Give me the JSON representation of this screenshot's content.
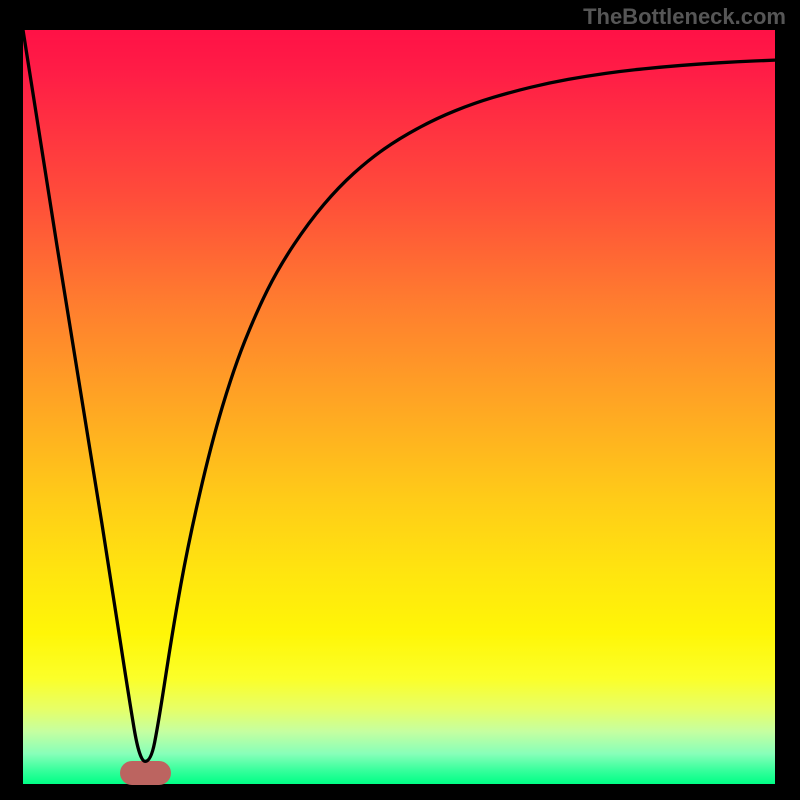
{
  "watermark": "TheBottleneck.com",
  "chart_data": {
    "type": "line",
    "title": "",
    "xlabel": "",
    "ylabel": "",
    "xlim": [
      0,
      100
    ],
    "ylim": [
      0,
      100
    ],
    "series": [
      {
        "name": "bottleneck-curve",
        "x": [
          0,
          3,
          6,
          9,
          12,
          14,
          15.5,
          17,
          18,
          20,
          22,
          25,
          28,
          31,
          34,
          38,
          42,
          46,
          50,
          55,
          60,
          65,
          70,
          75,
          80,
          85,
          90,
          95,
          100
        ],
        "values": [
          100,
          81,
          62,
          44,
          25,
          12,
          3,
          3,
          8,
          21,
          32,
          45,
          55,
          62.5,
          68.5,
          74.5,
          79.2,
          82.8,
          85.6,
          88.3,
          90.3,
          91.8,
          93.0,
          93.9,
          94.6,
          95.1,
          95.5,
          95.8,
          96.0
        ]
      }
    ],
    "annotations": [
      {
        "name": "optimal-marker",
        "x_center": 16.3,
        "y_center": 1.5,
        "width": 6.7,
        "height": 3.2
      }
    ],
    "gradient": {
      "top": "#ff1146",
      "mid": "#ffd316",
      "bottom": "#00ff86"
    }
  }
}
